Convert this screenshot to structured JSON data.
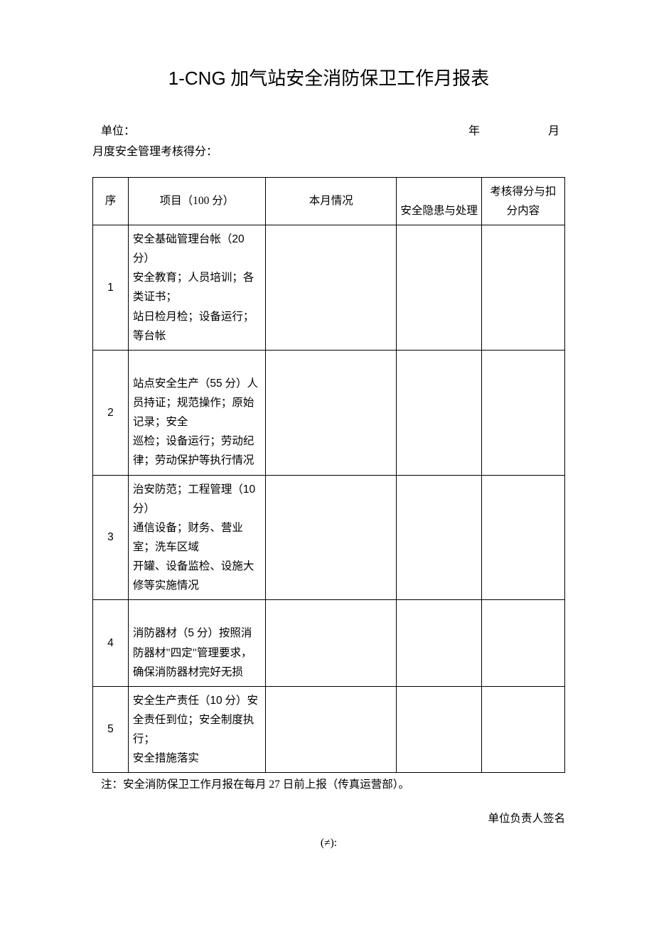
{
  "title_prefix": "1-CNG",
  "title_suffix": "加气站安全消防保卫工作月报表",
  "meta": {
    "unit_label": "单位：",
    "year_label": "年",
    "month_label": "月",
    "score_label": "月度安全管理考核得分："
  },
  "header": {
    "seq": "序",
    "item": "项目（100 分）",
    "situation": "本月情况",
    "hazard": "安全隐患与处理",
    "score": "考核得分与扣分内容"
  },
  "rows": [
    {
      "seq": "1",
      "item": "安全基础管理台帐（20 分）\n安全教育；人员培训；各类证书；\n站日检月检；设备运行；等台帐"
    },
    {
      "seq": "2",
      "item": "\n站点安全生产（55 分）人员持证；规范操作；原始记录；安全\n巡检；设备运行；劳动纪律；劳动保护等执行情况"
    },
    {
      "seq": "3",
      "item": "治安防范；工程管理（10 分）\n通信设备；财务、营业室；洗车区域\n开罐、设备监检、设施大修等实施情况"
    },
    {
      "seq": "4",
      "item": "\n消防器材（5 分）按照消防器材\"四定\"管理要求，\n确保消防器材完好无损"
    },
    {
      "seq": "5",
      "item": "安全生产责任（10 分）安全责任到位；安全制度执行；\n安全措施落实"
    }
  ],
  "note": "注：安全消防保卫工作月报在每月 27 日前上报（传真运营部）。",
  "signature": {
    "line1": "单位负责人签名",
    "line2": "(≠):"
  }
}
